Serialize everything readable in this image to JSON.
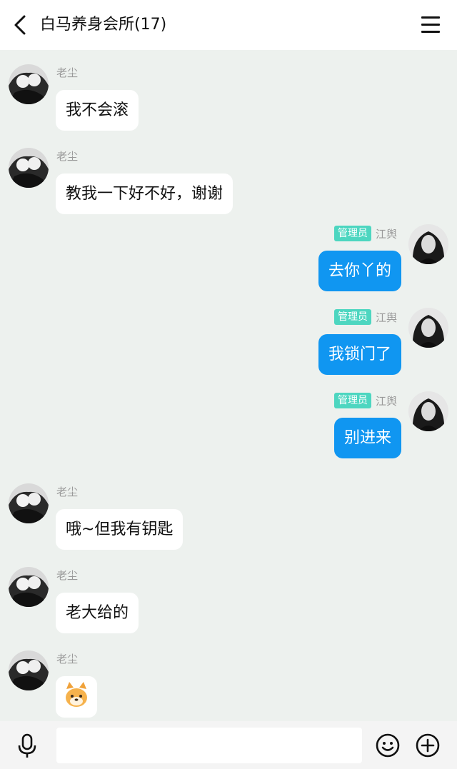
{
  "header": {
    "title": "白马养身会所(17)"
  },
  "messages": [
    {
      "side": "left",
      "name": "老尘",
      "text": "我不会滚"
    },
    {
      "side": "left",
      "name": "老尘",
      "text": "教我一下好不好，谢谢"
    },
    {
      "side": "right",
      "badge": "管理员",
      "name": "江舆",
      "text": "去你丫的"
    },
    {
      "side": "right",
      "badge": "管理员",
      "name": "江舆",
      "text": "我锁门了"
    },
    {
      "side": "right",
      "badge": "管理员",
      "name": "江舆",
      "text": "别进来"
    },
    {
      "side": "left",
      "name": "老尘",
      "text": "哦~但我有钥匙"
    },
    {
      "side": "left",
      "name": "老尘",
      "text": "老大给的"
    },
    {
      "side": "left",
      "name": "老尘",
      "text": "🐶",
      "sticker": "dog-face-emoji"
    }
  ],
  "footer": {
    "input_value": "",
    "input_placeholder": ""
  },
  "icons": {
    "back": "back-chevron-icon",
    "menu": "menu-icon",
    "mic": "microphone-icon",
    "emoji": "smiley-icon",
    "plus": "plus-circle-icon"
  },
  "colors": {
    "header_bg": "#ffffff",
    "chat_bg": "#edf1ee",
    "right_bubble": "#1096f1",
    "left_bubble": "#ffffff",
    "admin_badge": "#4dd6c0"
  }
}
